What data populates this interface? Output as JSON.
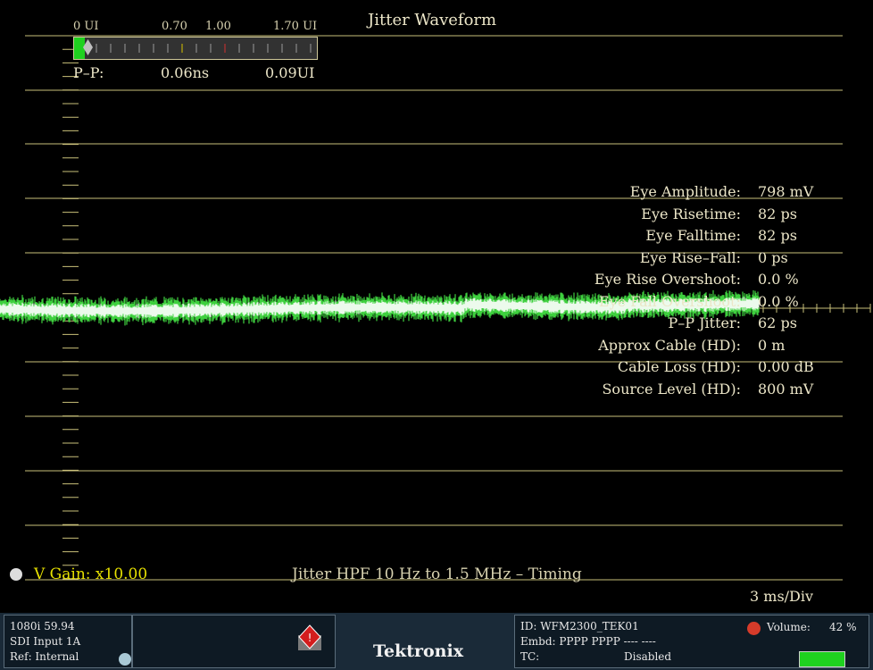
{
  "header": {
    "title": "Jitter Waveform"
  },
  "meter": {
    "ticks": [
      "0 UI",
      "0.70",
      "1.00",
      "1.70 UI"
    ],
    "pp_label": "P–P:",
    "pp_ns": "0.06ns",
    "pp_ui": "0.09UI",
    "level_ui": 0.09
  },
  "measurements": [
    {
      "label": "Eye Amplitude:",
      "value": "798 mV"
    },
    {
      "label": "Eye Risetime:",
      "value": "82 ps"
    },
    {
      "label": "Eye Falltime:",
      "value": "82 ps"
    },
    {
      "label": "Eye Rise–Fall:",
      "value": "0 ps"
    },
    {
      "label": "Eye Rise Overshoot:",
      "value": "0.0 %"
    },
    {
      "label": "Eye Fall Overshoot:",
      "value": "0.0 %"
    },
    {
      "label": "P–P Jitter:",
      "value": "62 ps"
    },
    {
      "label": "Approx Cable (HD):",
      "value": "0 m"
    },
    {
      "label": "Cable Loss (HD):",
      "value": "0.00 dB"
    },
    {
      "label": "Source Level (HD):",
      "value": "800 mV"
    }
  ],
  "footer": {
    "vgain": "V Gain: x10.00",
    "filter": "Jitter HPF 10 Hz to 1.5 MHz – Timing",
    "timediv": "3 ms/Div"
  },
  "status": {
    "format": "1080i 59.94",
    "input": "SDI Input 1A",
    "ref": "Ref: Internal",
    "brand": "Tektronix",
    "id": "ID: WFM2300_TEK01",
    "embd": "Embd: PPPP PPPP ---- ----",
    "tc_label": "TC:",
    "tc_value": "Disabled",
    "volume_label": "Volume:",
    "volume_value": "42 %"
  },
  "colors": {
    "graticule": "#c9c07a",
    "trace": "#3fd03f",
    "trace_core": "#ffffff",
    "meter_fill": "#1fd11f",
    "vgain": "#e6e000"
  }
}
